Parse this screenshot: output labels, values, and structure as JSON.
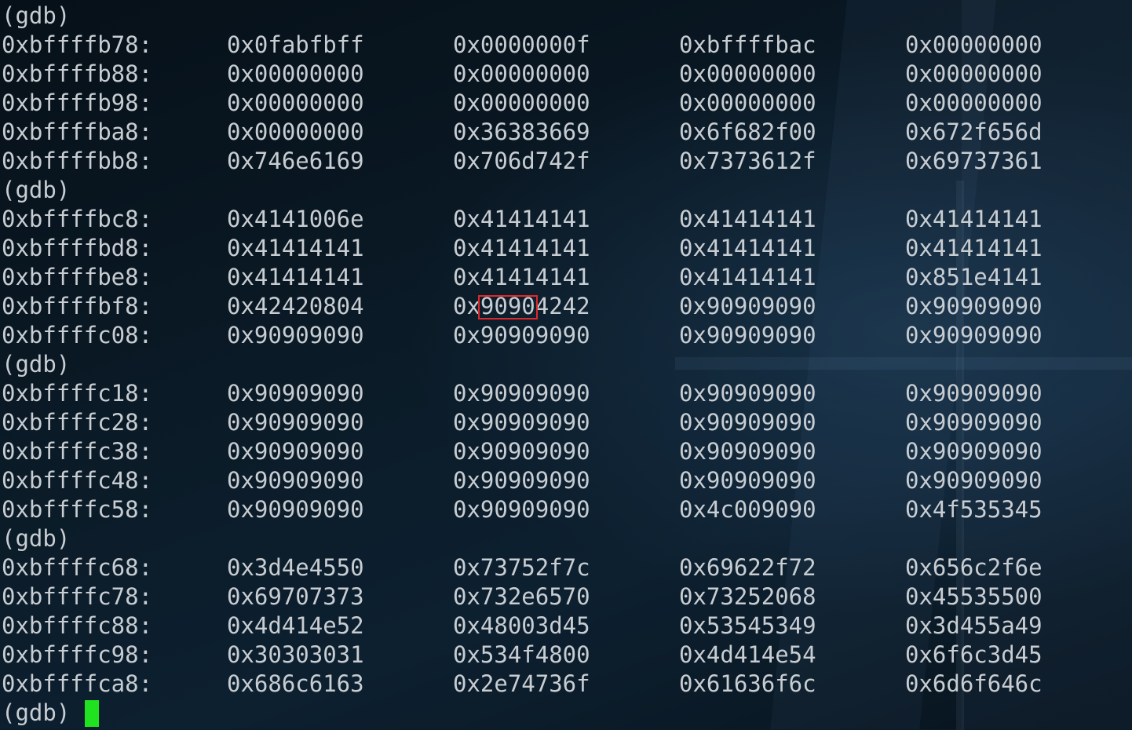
{
  "terminal": {
    "prompt": "(gdb)",
    "rows": [
      {
        "kind": "prompt",
        "text": "(gdb)"
      },
      {
        "kind": "mem",
        "addr": "0xbffffb78:",
        "w": [
          "0x0fabfbff",
          "0x0000000f",
          "0xbffffbac",
          "0x00000000"
        ]
      },
      {
        "kind": "mem",
        "addr": "0xbffffb88:",
        "w": [
          "0x00000000",
          "0x00000000",
          "0x00000000",
          "0x00000000"
        ]
      },
      {
        "kind": "mem",
        "addr": "0xbffffb98:",
        "w": [
          "0x00000000",
          "0x00000000",
          "0x00000000",
          "0x00000000"
        ]
      },
      {
        "kind": "mem",
        "addr": "0xbffffba8:",
        "w": [
          "0x00000000",
          "0x36383669",
          "0x6f682f00",
          "0x672f656d"
        ]
      },
      {
        "kind": "mem",
        "addr": "0xbffffbb8:",
        "w": [
          "0x746e6169",
          "0x706d742f",
          "0x7373612f",
          "0x69737361"
        ]
      },
      {
        "kind": "prompt",
        "text": "(gdb)"
      },
      {
        "kind": "mem",
        "addr": "0xbffffbc8:",
        "w": [
          "0x4141006e",
          "0x41414141",
          "0x41414141",
          "0x41414141"
        ]
      },
      {
        "kind": "mem",
        "addr": "0xbffffbd8:",
        "w": [
          "0x41414141",
          "0x41414141",
          "0x41414141",
          "0x41414141"
        ]
      },
      {
        "kind": "mem",
        "addr": "0xbffffbe8:",
        "w": [
          "0x41414141",
          "0x41414141",
          "0x41414141",
          "0x851e4141"
        ]
      },
      {
        "kind": "mem",
        "addr": "0xbffffbf8:",
        "w": [
          "0x42420804",
          "0x90904242",
          "0x90909090",
          "0x90909090"
        ]
      },
      {
        "kind": "mem",
        "addr": "0xbffffc08:",
        "w": [
          "0x90909090",
          "0x90909090",
          "0x90909090",
          "0x90909090"
        ]
      },
      {
        "kind": "prompt",
        "text": "(gdb)"
      },
      {
        "kind": "mem",
        "addr": "0xbffffc18:",
        "w": [
          "0x90909090",
          "0x90909090",
          "0x90909090",
          "0x90909090"
        ]
      },
      {
        "kind": "mem",
        "addr": "0xbffffc28:",
        "w": [
          "0x90909090",
          "0x90909090",
          "0x90909090",
          "0x90909090"
        ]
      },
      {
        "kind": "mem",
        "addr": "0xbffffc38:",
        "w": [
          "0x90909090",
          "0x90909090",
          "0x90909090",
          "0x90909090"
        ]
      },
      {
        "kind": "mem",
        "addr": "0xbffffc48:",
        "w": [
          "0x90909090",
          "0x90909090",
          "0x90909090",
          "0x90909090"
        ]
      },
      {
        "kind": "mem",
        "addr": "0xbffffc58:",
        "w": [
          "0x90909090",
          "0x90909090",
          "0x4c009090",
          "0x4f535345"
        ]
      },
      {
        "kind": "prompt",
        "text": "(gdb)"
      },
      {
        "kind": "mem",
        "addr": "0xbffffc68:",
        "w": [
          "0x3d4e4550",
          "0x73752f7c",
          "0x69622f72",
          "0x656c2f6e"
        ]
      },
      {
        "kind": "mem",
        "addr": "0xbffffc78:",
        "w": [
          "0x69707373",
          "0x732e6570",
          "0x73252068",
          "0x45535500"
        ]
      },
      {
        "kind": "mem",
        "addr": "0xbffffc88:",
        "w": [
          "0x4d414e52",
          "0x48003d45",
          "0x53545349",
          "0x3d455a49"
        ]
      },
      {
        "kind": "mem",
        "addr": "0xbffffc98:",
        "w": [
          "0x30303031",
          "0x534f4800",
          "0x4d414e54",
          "0x6f6c3d45"
        ]
      },
      {
        "kind": "mem",
        "addr": "0xbffffca8:",
        "w": [
          "0x686c6163",
          "0x2e74736f",
          "0x61636f6c",
          "0x6d6f646c"
        ]
      },
      {
        "kind": "prompt",
        "text": "(gdb)"
      }
    ]
  },
  "colors": {
    "text": "#c8cdd2",
    "cursor": "#21e221",
    "highlight": "#e0282b"
  }
}
